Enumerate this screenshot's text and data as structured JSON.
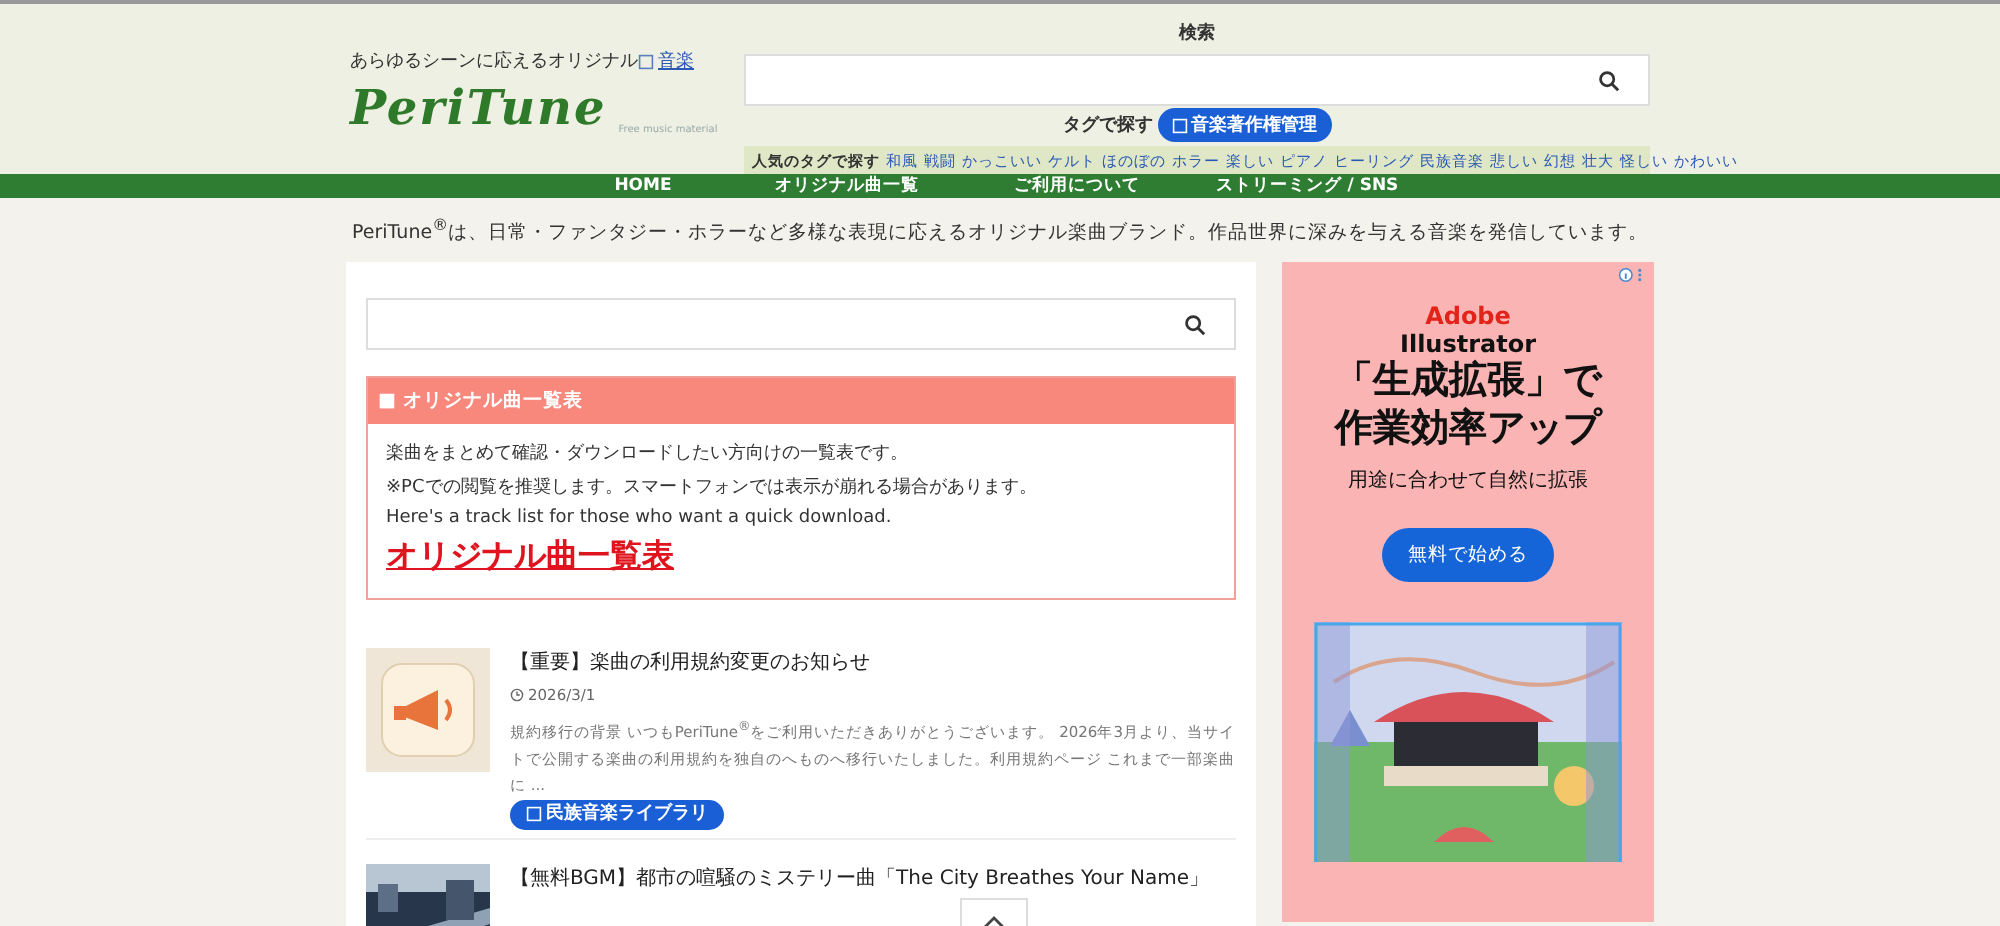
{
  "header": {
    "tagline": "あらゆるシーンに応えるオリジナル",
    "tagline_link": "音楽",
    "logo": "PeriTune",
    "logo_sub": "Free music material",
    "search_label": "検索",
    "tag_search_label": "タグで探す",
    "tag_pill": "音楽著作権管理",
    "popular_label": "人気のタグで探す",
    "popular_tags": [
      "和風",
      "戦闘",
      "かっこいい",
      "ケルト",
      "ほのぼの",
      "ホラー",
      "楽しい",
      "ピアノ",
      "ヒーリング",
      "民族音楽",
      "悲しい",
      "幻想",
      "壮大",
      "怪しい",
      "かわいい"
    ]
  },
  "nav": [
    {
      "label": "HOME"
    },
    {
      "label": "オリジナル曲一覧"
    },
    {
      "label": "ご利用について"
    },
    {
      "label": "ストリーミング / SNS"
    }
  ],
  "intro": "PeriTune$^{®}$は、日常・ファンタジー・ホラーなど多様な表現に応えるオリジナル楽曲ブランド。作品世界に深みを与える音楽を発信しています。",
  "notice": {
    "title": "■ オリジナル曲一覧表",
    "lines": [
      "楽曲をまとめて確認・ダウンロードしたい方向けの一覧表です。",
      "※PCでの閲覧を推奨します。スマートフォンでは表示が崩れる場合があります。",
      "Here's a track list for those who want a quick download."
    ],
    "link": "オリジナル曲一覧表"
  },
  "posts": [
    {
      "kind": "notice",
      "title": "【重要】楽曲の利用規約変更のお知らせ",
      "date": "2026/3/1",
      "excerpt": "規約移行の背景 いつもPeriTune$^{®}$をご利用いただきありがとうございます。 2026年3月より、当サイトで公開する楽曲の利用規約を独自のへものへ移行いたしました。利用規約ページ これまで一部楽曲に ...",
      "pill": "民族音楽ライブラリ"
    },
    {
      "kind": "city",
      "title": "【無料BGM】都市の喧騒のミステリー曲「The City Breathes Your Name」"
    }
  ],
  "ad": {
    "brand_line1": "Adobe",
    "brand_line2": "Illustrator",
    "headline1": "「生成拡張」で",
    "headline2": "作業効率アップ",
    "sub": "用途に合わせて自然に拡張",
    "cta": "無料で始める"
  }
}
